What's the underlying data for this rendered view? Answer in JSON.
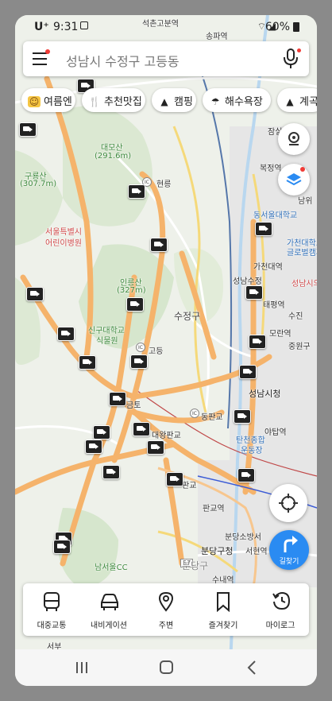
{
  "status_bar": {
    "carrier": "U⁺",
    "time": "9:31",
    "battery": "60%"
  },
  "search": {
    "placeholder": "성남시 수정구 고등동"
  },
  "chips": [
    {
      "icon": "summer-icon",
      "label": "여름엔"
    },
    {
      "icon": "restaurant-icon",
      "label": "추천맛집"
    },
    {
      "icon": "camping-icon",
      "label": "캠핑"
    },
    {
      "icon": "beach-icon",
      "label": "해수욕장"
    },
    {
      "icon": "valley-icon",
      "label": "계곡"
    }
  ],
  "map": {
    "labels": {
      "seokcheon": "석촌고분역",
      "songpa": "송파역",
      "daemosan": "대모산",
      "daemosan_h": "(291.6m)",
      "gurongsan": "구룡산",
      "gurongsan_h": "(307.7m)",
      "hospital": "서울특별시",
      "hospital2": "어린이병원",
      "hyeonryeong": "현릉",
      "inneungsan": "인릉산",
      "inneungsan_h": "(327m)",
      "singu": "신구대학교",
      "singu2": "식물원",
      "sujeong": "수정구",
      "godeung": "고등",
      "geumto": "금토",
      "daewang": "대왕판교",
      "dongpan": "동판교",
      "seongnam_city": "성남시청",
      "jamsil": "잠실",
      "bokjeong": "복정역",
      "namwi": "남위",
      "dongseoul_univ": "동서울대학교",
      "gachon_univ": "가천대학교",
      "global": "글로벌캠퍼",
      "gachon_st": "가천대역",
      "seongnam_sujeong": "성남수정",
      "seongnam_si": "성남시의",
      "taepyeong": "태평역",
      "moran": "모란역",
      "jungwon": "중원구",
      "sujin": "수진",
      "yatap": "야탑역",
      "tancheon": "탄천종합",
      "stadium": "운동장",
      "pangyo": "판교역",
      "bundang_fire": "분당소방서",
      "bundang_gu": "분당구청",
      "seohyeon": "서현역",
      "sunae": "수내역",
      "bundang": "분당구",
      "namseoul_cc": "남서울CC",
      "pangyo_ic": "판교",
      "road57": "57",
      "seobu": "서부"
    }
  },
  "route_button": {
    "label": "길찾기"
  },
  "bottom_nav": [
    {
      "icon": "bus-icon",
      "label": "대중교통"
    },
    {
      "icon": "car-icon",
      "label": "내비게이션"
    },
    {
      "icon": "location-pin-icon",
      "label": "주변"
    },
    {
      "icon": "bookmark-icon",
      "label": "즐겨찾기"
    },
    {
      "icon": "history-icon",
      "label": "마이로그"
    }
  ]
}
